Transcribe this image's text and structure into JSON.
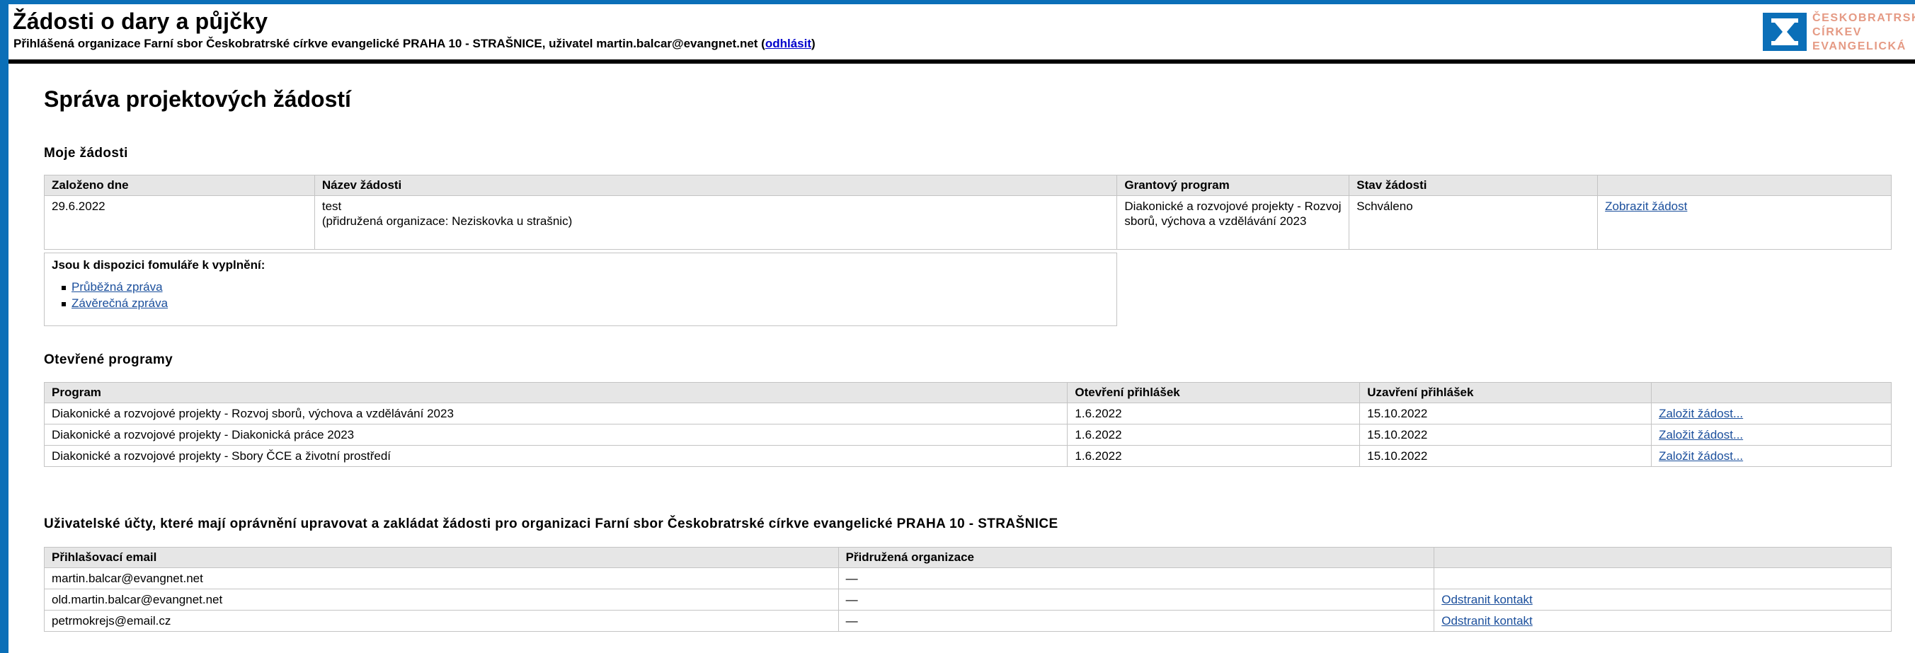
{
  "header": {
    "title": "Žádosti o dary a půjčky",
    "login_prefix": "Přihlášená organizace Farní sbor Českobratrské církve evangelické PRAHA 10 - STRAŠNICE, uživatel martin.balcar@evangnet.net (",
    "logout_label": "odhlásit",
    "login_suffix": ")",
    "logo_lines": [
      "ČESKOBRATRSKÁ",
      "CÍRKEV",
      "EVANGELICKÁ"
    ],
    "logo_icon": "church-logo-icon"
  },
  "page_title": "Správa projektových žádostí",
  "my_requests": {
    "title": "Moje žádosti",
    "columns": [
      "Založeno dne",
      "Název žádosti",
      "Grantový program",
      "Stav žádosti",
      ""
    ],
    "rows": [
      {
        "date": "29.6.2022",
        "name": "test",
        "name_note": "(přidružená organizace: Neziskovka u strašnic)",
        "program": "Diakonické a rozvojové projekty - Rozvoj sborů, výchova a vzdělávání 2023",
        "status": "Schváleno",
        "action": "Zobrazit žádost"
      }
    ],
    "forms_heading": "Jsou k dispozici fomuláře k vyplnění:",
    "forms": [
      "Průběžná zpráva",
      "Závěrečná zpráva"
    ]
  },
  "open_programs": {
    "title": "Otevřené programy",
    "columns": [
      "Program",
      "Otevření přihlášek",
      "Uzavření přihlášek",
      ""
    ],
    "rows": [
      {
        "program": "Diakonické a rozvojové projekty - Rozvoj sborů, výchova a vzdělávání 2023",
        "open": "1.6.2022",
        "close": "15.10.2022",
        "action": "Založit žádost..."
      },
      {
        "program": "Diakonické a rozvojové projekty - Diakonická práce 2023",
        "open": "1.6.2022",
        "close": "15.10.2022",
        "action": "Založit žádost..."
      },
      {
        "program": "Diakonické a rozvojové projekty - Sbory ČCE a životní prostředí",
        "open": "1.6.2022",
        "close": "15.10.2022",
        "action": "Založit žádost..."
      }
    ]
  },
  "user_accounts": {
    "title": "Uživatelské účty, které mají oprávnění upravovat a zakládat žádosti pro organizaci Farní sbor Českobratrské církve evangelické PRAHA 10 - STRAŠNICE",
    "columns": [
      "Přihlašovací email",
      "Přidružená organizace",
      ""
    ],
    "rows": [
      {
        "email": "martin.balcar@evangnet.net",
        "org": "—",
        "action": ""
      },
      {
        "email": "old.martin.balcar@evangnet.net",
        "org": "—",
        "action": "Odstranit kontakt"
      },
      {
        "email": "petrmokrejs@email.cz",
        "org": "—",
        "action": "Odstranit kontakt"
      }
    ]
  },
  "colors": {
    "frame_blue": "#0b6fb8",
    "logo_orange": "#e59a84",
    "link": "#1b4f9c"
  }
}
